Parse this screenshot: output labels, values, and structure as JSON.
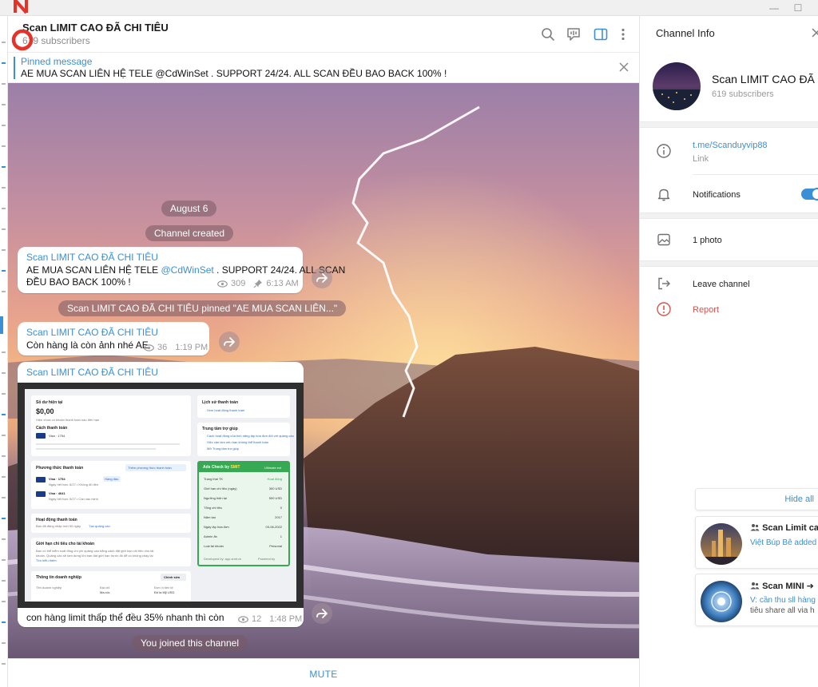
{
  "window": {
    "minimize_glyph": "—",
    "maximize_glyph": "☐"
  },
  "chat": {
    "title": "Scan LIMIT CAO ĐÃ CHI TIÊU",
    "subscribers": "619 subscribers",
    "header_icons": [
      "search-icon",
      "video-chat-icon",
      "sidebar-toggle-icon",
      "more-vertical-icon"
    ],
    "accent_color": "#3a8fd6"
  },
  "pinned": {
    "label": "Pinned message",
    "text": "AE MUA SCAN LIÊN HỆ TELE @CdWinSet . SUPPORT 24/24. ALL SCAN ĐỀU BAO BACK 100% !"
  },
  "service": {
    "date": "August 6",
    "created": "Channel created",
    "pinned_notice": "Scan LIMIT CAO ĐÃ CHI TIÊU pinned \"AE MUA SCAN LIÊN...\"",
    "joined": "You joined this channel"
  },
  "messages": [
    {
      "author": "Scan LIMIT CAO ĐÃ CHI TIÊU",
      "text_before": "AE MUA SCAN LIÊN HỆ TELE ",
      "mention": "@CdWinSet",
      "text_after": " . SUPPORT 24/24. ALL SCAN",
      "text_line2": "ĐỀU BAO BACK 100% !",
      "views": "309",
      "time": "6:13 AM"
    },
    {
      "author": "Scan LIMIT CAO ĐÃ CHI TIÊU",
      "text": "Còn hàng là còn ảnh nhé AE",
      "views": "36",
      "time": "1:19 PM"
    },
    {
      "author": "Scan LIMIT CAO ĐÃ CHI TIÊU",
      "caption": "con hàng limit thấp thể đều 35% nhanh thì còn",
      "views": "12",
      "time": "1:48 PM"
    }
  ],
  "screenshot": {
    "balance_title": "Số dư hiện tại",
    "balance_value": "$0,00",
    "balance_sub": "Hiện chưa có khoản thanh toán nào đến hạn",
    "pay_method_title": "Cách thanh toán",
    "card_1": "Visa · 1754",
    "pay_methods_title": "Phương thức thanh toán",
    "add_method": "Thêm phương thức thanh toán",
    "visa_1754": "Visa · 1754",
    "visa_1754_sub": "Ngày hết hạn: 6/27 • Không đủ tiền",
    "visa_1754_badge": "Hàng đầu",
    "visa_4641": "Visa · 4641",
    "visa_4641_sub": "Ngày hết hạn: 5/27 • Cần xác minh",
    "activity_title": "Hoạt động thanh toán",
    "activity_sub": "Bạn đã đăng nhập mới 90 ngày",
    "activity_link": "Tạo quảng cáo",
    "limit_title": "Giới hạn chi tiêu cho tài khoản",
    "limit_sub1": "Bạn có thể kiểm soát tổng chi phí quảng cáo bằng cách đặt giới hạn chi tiêu cho tài",
    "limit_sub2": "khoản. Quảng cáo sẽ tạm dừng khi bạn đạt giới hạn trước đó để có không chạy lại",
    "limit_link": "Tìm hiểu thêm",
    "biz_title": "Thông tin doanh nghiệp",
    "biz_edit": "Chỉnh sửa",
    "biz_col1": "Tên doanh nghiệp",
    "biz_col2": "Địa chỉ",
    "biz_col3": "Đơn vị tiền tệ",
    "biz_val2": "Ma-rốc",
    "biz_val3": "Đô la Mỹ USD",
    "history_title": "Lịch sử thanh toán",
    "history_link": "Xem hoạt động thanh toán",
    "help_title": "Trung tâm trợ giúp",
    "help_1": "Cách hoạt động của tính năng lập hóa đơn đối với quảng cáo",
    "help_2": "Việc cần làm nếu bạn không thể thanh toán",
    "help_3": "Mở Trung tâm trợ giúp",
    "ads_title": "Ads Check by",
    "ads_brand": "SMIT",
    "ads_badge": "Ultimate ext",
    "ads_rows": [
      {
        "label": "Trạng thái TK",
        "value": "Hoạt động"
      },
      {
        "label": "Giới hạn chi tiêu (ngày)",
        "value": "300 USD"
      },
      {
        "label": "Ngưỡng hiện tại",
        "value": "500 USD"
      },
      {
        "label": "Tổng chi tiêu",
        "value": "0"
      },
      {
        "label": "Năm tạo",
        "value": "2017"
      },
      {
        "label": "Ngày lập hóa đơn",
        "value": "03-06-2022"
      },
      {
        "label": "Admin ẩn",
        "value": "1"
      },
      {
        "label": "Loại tài khoản",
        "value": "Personal"
      }
    ],
    "ads_footer": "Developed by: app.smit.vn",
    "ads_footer_right": "Powered by"
  },
  "mute_label": "MUTE",
  "info": {
    "title": "Channel Info",
    "name": "Scan LIMIT CAO ĐÃ ...",
    "subscribers": "619 subscribers",
    "link": "t.me/Scanduyvip88",
    "link_label": "Link",
    "notifications": "Notifications",
    "notifications_on": true,
    "photos": "1 photo",
    "leave": "Leave channel",
    "report": "Report",
    "report_color": "#d9534f"
  },
  "notifications_popup": {
    "hide_all": "Hide all",
    "items": [
      {
        "title": "Scan Limit cao",
        "body": "Việt Búp Bê added"
      },
      {
        "title": "Scan MINI ➔",
        "body_line1": "V: cần thu sll hàng",
        "body_line2": "tiêu share all via h"
      }
    ]
  }
}
